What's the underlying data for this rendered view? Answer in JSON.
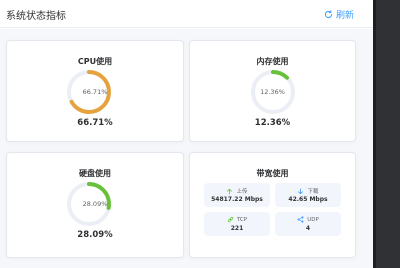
{
  "header": {
    "title": "系统状态指标",
    "refresh_label": "刷新"
  },
  "gauges": {
    "cpu": {
      "title": "CPU使用",
      "percent": 66.71,
      "center_text": "66.71%",
      "value_text": "66.71%",
      "color": "#e6a23c"
    },
    "memory": {
      "title": "内存使用",
      "percent": 12.36,
      "center_text": "12.36%",
      "value_text": "12.36%",
      "color": "#67c23a"
    },
    "disk": {
      "title": "硬盘使用",
      "percent": 28.09,
      "center_text": "28.09%",
      "value_text": "28.09%",
      "color": "#67c23a"
    }
  },
  "bandwidth": {
    "title": "带宽使用",
    "upload": {
      "label": "上传",
      "value": "54817.22 Mbps",
      "icon": "upload-arrow-icon",
      "color": "#67c23a"
    },
    "download": {
      "label": "下载",
      "value": "42.65 Mbps",
      "icon": "download-arrow-icon",
      "color": "#409eff"
    },
    "tcp": {
      "label": "TCP",
      "value": "221",
      "icon": "link-icon",
      "color": "#67c23a"
    },
    "udp": {
      "label": "UDP",
      "value": "4",
      "icon": "share-nodes-icon",
      "color": "#409eff"
    }
  },
  "colors": {
    "track": "#ebeef5",
    "accent": "#409eff"
  }
}
